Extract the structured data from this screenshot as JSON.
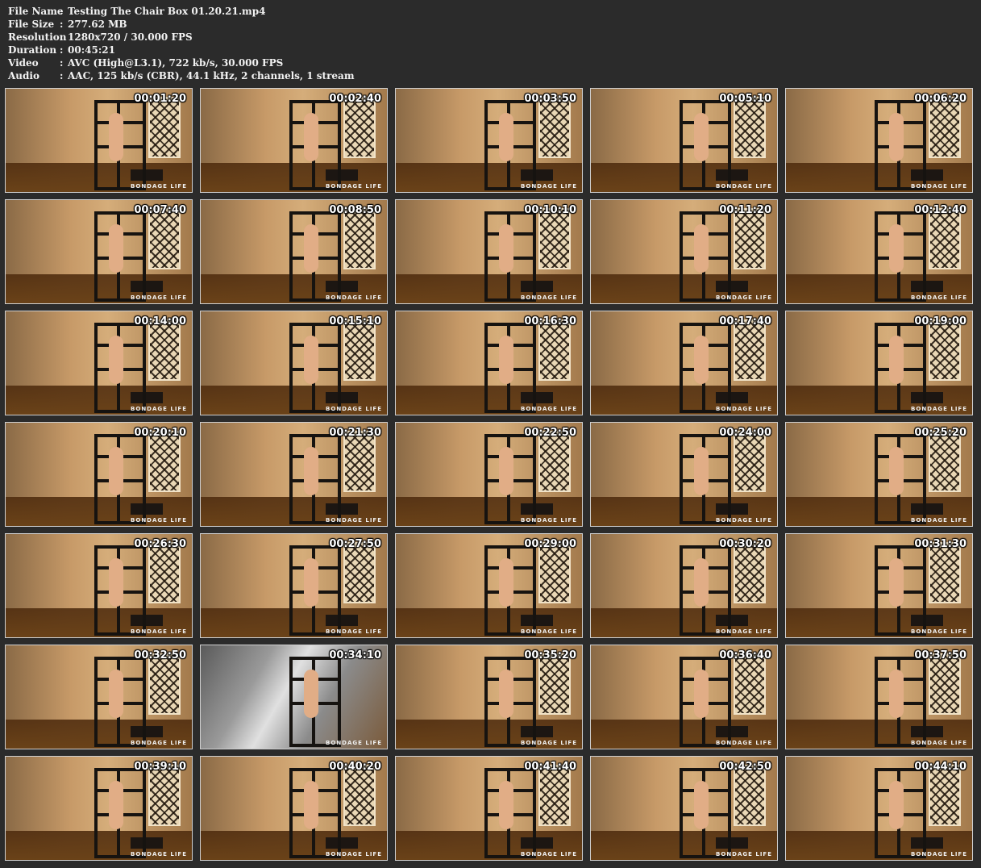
{
  "info": [
    {
      "label": "File Name",
      "value": "Testing The Chair Box 01.20.21.mp4"
    },
    {
      "label": "File Size",
      "value": "277.62 MB"
    },
    {
      "label": "Resolution",
      "value": "1280x720 / 30.000 FPS"
    },
    {
      "label": "Duration",
      "value": "00:45:21"
    },
    {
      "label": "Video",
      "value": "AVC (High@L3.1), 722 kb/s, 30.000 FPS"
    },
    {
      "label": "Audio",
      "value": "AAC, 125 kb/s (CBR), 44.1 kHz, 2 channels, 1 stream"
    }
  ],
  "separator": ":",
  "logo_text": "BONDAGE LIFE",
  "thumbnails": [
    "00:01:20",
    "00:02:40",
    "00:03:50",
    "00:05:10",
    "00:06:20",
    "00:07:40",
    "00:08:50",
    "00:10:10",
    "00:11:20",
    "00:12:40",
    "00:14:00",
    "00:15:10",
    "00:16:30",
    "00:17:40",
    "00:19:00",
    "00:20:10",
    "00:21:30",
    "00:22:50",
    "00:24:00",
    "00:25:20",
    "00:26:30",
    "00:27:50",
    "00:29:00",
    "00:30:20",
    "00:31:30",
    "00:32:50",
    "00:34:10",
    "00:35:20",
    "00:36:40",
    "00:37:50",
    "00:39:10",
    "00:40:20",
    "00:41:40",
    "00:42:50",
    "00:44:10"
  ],
  "colors": {
    "background": "#2b2b2b",
    "text": "#f2f2f2",
    "thumb_border": "#cfcfcf"
  }
}
